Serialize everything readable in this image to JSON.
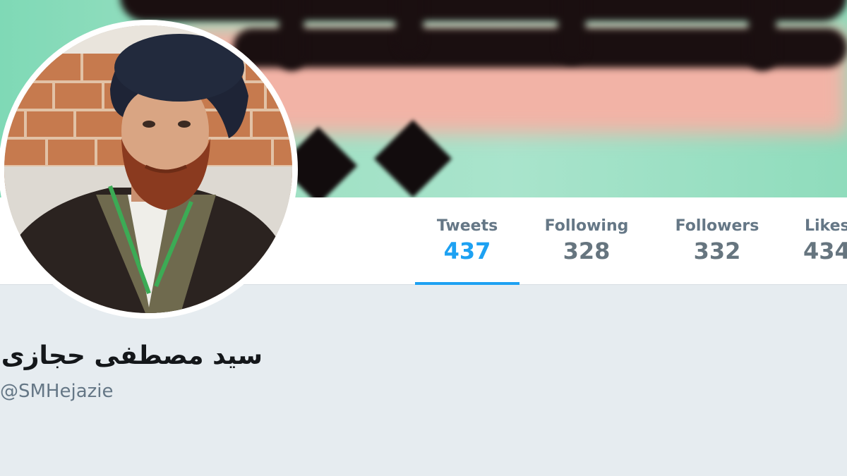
{
  "profile": {
    "display_name": "سید مصطفی حجازی",
    "handle": "@SMHejazie"
  },
  "stats": [
    {
      "label": "Tweets",
      "value": "437",
      "active": true
    },
    {
      "label": "Following",
      "value": "328",
      "active": false
    },
    {
      "label": "Followers",
      "value": "332",
      "active": false
    },
    {
      "label": "Likes",
      "value": "434",
      "active": false
    }
  ],
  "colors": {
    "accent": "#1da1f2",
    "page_background": "#e6ecf0",
    "stat_text": "#657786"
  }
}
